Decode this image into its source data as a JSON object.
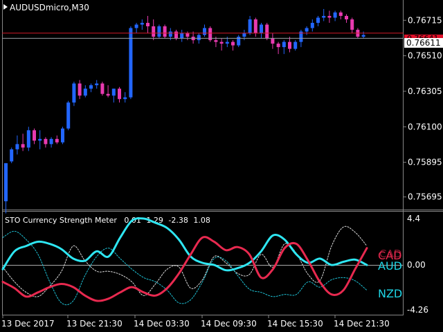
{
  "title": "AUDUSDmicro,M30",
  "price_axis": {
    "ticks": [
      "0.76715",
      "0.76510",
      "0.76305",
      "0.76100",
      "0.75895",
      "0.75695"
    ],
    "current_price": "0.76611",
    "line_price_label": "0.76641"
  },
  "indicator": {
    "title": "STO Currency Strength Meter",
    "values": [
      "0.01",
      "1.29",
      "-2.38",
      "1.08"
    ],
    "axis_ticks": [
      "4.4",
      "0.00",
      "-4.26"
    ],
    "currency_labels": [
      {
        "name": "CAD",
        "color": "#e8294f"
      },
      {
        "name": "AUD",
        "color": "#1ed6e6"
      },
      {
        "name": "NZD",
        "color": "#1ed6e6"
      }
    ]
  },
  "time_axis": {
    "ticks": [
      "13 Dec 2017",
      "13 Dec 21:30",
      "14 Dec 03:30",
      "14 Dec 09:30",
      "14 Dec 15:30",
      "14 Dec 21:30"
    ]
  },
  "colors": {
    "background": "#000000",
    "bull_candle": "#2266ff",
    "bear_candle": "#e83ab0",
    "cad": "#e8294f",
    "aud": "#2ee6f2",
    "nzd": "#1ec4d8"
  },
  "chart_data": {
    "type": "candlestick",
    "y_range": [
      0.7565,
      0.768
    ],
    "candles": [
      [
        0.7567,
        0.7589,
        0.756,
        0.7589
      ],
      [
        0.759,
        0.7598,
        0.7589,
        0.7597
      ],
      [
        0.7597,
        0.7605,
        0.7594,
        0.76
      ],
      [
        0.76,
        0.7606,
        0.7596,
        0.7598
      ],
      [
        0.7598,
        0.761,
        0.7596,
        0.7608
      ],
      [
        0.7608,
        0.7609,
        0.76,
        0.7602
      ],
      [
        0.7602,
        0.7608,
        0.7597,
        0.7603
      ],
      [
        0.7603,
        0.7604,
        0.7598,
        0.76
      ],
      [
        0.76,
        0.7604,
        0.7598,
        0.7603
      ],
      [
        0.7603,
        0.7605,
        0.76,
        0.7601
      ],
      [
        0.7601,
        0.761,
        0.76,
        0.7609
      ],
      [
        0.7609,
        0.7625,
        0.7608,
        0.7624
      ],
      [
        0.7624,
        0.7636,
        0.7622,
        0.7635
      ],
      [
        0.7635,
        0.7637,
        0.7626,
        0.7628
      ],
      [
        0.7628,
        0.7634,
        0.7627,
        0.7632
      ],
      [
        0.7632,
        0.7635,
        0.763,
        0.7634
      ],
      [
        0.7634,
        0.7637,
        0.7632,
        0.7635
      ],
      [
        0.7635,
        0.7636,
        0.7628,
        0.7629
      ],
      [
        0.7629,
        0.7634,
        0.7627,
        0.7628
      ],
      [
        0.7628,
        0.7632,
        0.7624,
        0.7632
      ],
      [
        0.7632,
        0.7633,
        0.7624,
        0.7626
      ],
      [
        0.7626,
        0.763,
        0.7624,
        0.7627
      ],
      [
        0.7627,
        0.7668,
        0.7626,
        0.7667
      ],
      [
        0.7667,
        0.767,
        0.7664,
        0.7669
      ],
      [
        0.7669,
        0.7672,
        0.7666,
        0.767
      ],
      [
        0.767,
        0.7674,
        0.7664,
        0.7668
      ],
      [
        0.7668,
        0.7672,
        0.766,
        0.7662
      ],
      [
        0.7662,
        0.7669,
        0.7661,
        0.7668
      ],
      [
        0.7668,
        0.7669,
        0.7661,
        0.7662
      ],
      [
        0.7662,
        0.7667,
        0.766,
        0.7665
      ],
      [
        0.7665,
        0.7666,
        0.766,
        0.7661
      ],
      [
        0.7661,
        0.7666,
        0.7659,
        0.7664
      ],
      [
        0.7664,
        0.7665,
        0.766,
        0.7662
      ],
      [
        0.7662,
        0.7665,
        0.7658,
        0.766
      ],
      [
        0.766,
        0.7664,
        0.7658,
        0.7663
      ],
      [
        0.7663,
        0.7669,
        0.7662,
        0.7667
      ],
      [
        0.7667,
        0.7668,
        0.7659,
        0.766
      ],
      [
        0.766,
        0.7662,
        0.7656,
        0.7659
      ],
      [
        0.7659,
        0.7661,
        0.7654,
        0.7658
      ],
      [
        0.7658,
        0.7662,
        0.7656,
        0.7659
      ],
      [
        0.7659,
        0.766,
        0.7654,
        0.7657
      ],
      [
        0.7657,
        0.7663,
        0.7656,
        0.7662
      ],
      [
        0.7662,
        0.7666,
        0.766,
        0.7664
      ],
      [
        0.7664,
        0.7674,
        0.7663,
        0.7672
      ],
      [
        0.7672,
        0.7673,
        0.7662,
        0.7664
      ],
      [
        0.7664,
        0.767,
        0.7661,
        0.7669
      ],
      [
        0.7669,
        0.767,
        0.766,
        0.7661
      ],
      [
        0.7661,
        0.7664,
        0.7655,
        0.7658
      ],
      [
        0.7658,
        0.7659,
        0.7652,
        0.7656
      ],
      [
        0.7656,
        0.766,
        0.7652,
        0.7659
      ],
      [
        0.7659,
        0.7662,
        0.7653,
        0.7655
      ],
      [
        0.7655,
        0.766,
        0.7654,
        0.7659
      ],
      [
        0.7659,
        0.7666,
        0.7656,
        0.7665
      ],
      [
        0.7665,
        0.7668,
        0.7663,
        0.7667
      ],
      [
        0.7667,
        0.7672,
        0.7665,
        0.767
      ],
      [
        0.767,
        0.7674,
        0.7668,
        0.7673
      ],
      [
        0.7673,
        0.7678,
        0.7671,
        0.7674
      ],
      [
        0.7674,
        0.7677,
        0.767,
        0.7673
      ],
      [
        0.7673,
        0.7677,
        0.7671,
        0.7676
      ],
      [
        0.7676,
        0.7677,
        0.7672,
        0.7674
      ],
      [
        0.7674,
        0.7675,
        0.767,
        0.7672
      ],
      [
        0.7672,
        0.7673,
        0.7664,
        0.7666
      ],
      [
        0.7666,
        0.7667,
        0.7661,
        0.7662
      ],
      [
        0.7662,
        0.7665,
        0.7661,
        0.7663
      ]
    ],
    "h_lines": [
      0.76641,
      0.76611
    ],
    "strength_range": [
      -4.26,
      4.4
    ],
    "series": [
      {
        "name": "CAD",
        "values": [
          -1.6,
          -2.2,
          -3.0,
          -2.6,
          -2.1,
          -1.8,
          -2.1,
          -2.9,
          -3.4,
          -3.2,
          -2.6,
          -2.1,
          -2.6,
          -2.9,
          -2.2,
          -0.8,
          1.0,
          2.6,
          2.2,
          1.4,
          1.7,
          1.0,
          -1.2,
          -0.4,
          1.6,
          2.0,
          0.4,
          -1.6,
          -2.8,
          -2.4,
          -0.4,
          1.6
        ]
      },
      {
        "name": "AUD",
        "values": [
          -0.4,
          1.3,
          1.8,
          2.2,
          2.0,
          1.5,
          0.6,
          0.4,
          1.3,
          0.8,
          2.6,
          4.2,
          4.4,
          4.0,
          3.5,
          2.4,
          0.8,
          0.2,
          0.0,
          -0.5,
          -0.3,
          0.2,
          1.3,
          2.8,
          2.4,
          1.0,
          0.2,
          0.6,
          0.0,
          0.3,
          0.5,
          0.0
        ]
      },
      {
        "name": "NZD",
        "values": [
          2.6,
          3.2,
          2.4,
          1.0,
          -1.6,
          -3.6,
          -3.4,
          -1.0,
          0.8,
          1.6,
          0.6,
          -0.4,
          -1.2,
          -1.6,
          -2.4,
          -3.6,
          -3.3,
          -1.6,
          0.6,
          0.4,
          -1.0,
          -2.3,
          -2.6,
          -3.0,
          -2.8,
          -2.8,
          -1.6,
          -2.1,
          -1.4,
          -1.2,
          -1.5,
          -2.4
        ]
      },
      {
        "name": "",
        "values": [
          -0.2,
          -1.6,
          -2.6,
          -3.0,
          -2.0,
          -0.6,
          1.8,
          0.4,
          -0.6,
          -0.6,
          -0.9,
          -1.6,
          -2.9,
          -1.8,
          -0.4,
          -0.2,
          -2.2,
          -1.4,
          0.8,
          0.2,
          -0.8,
          -0.9,
          1.0,
          -0.2,
          2.0,
          1.1,
          -0.9,
          -1.5,
          1.8,
          3.6,
          3.1,
          1.8
        ]
      }
    ]
  }
}
